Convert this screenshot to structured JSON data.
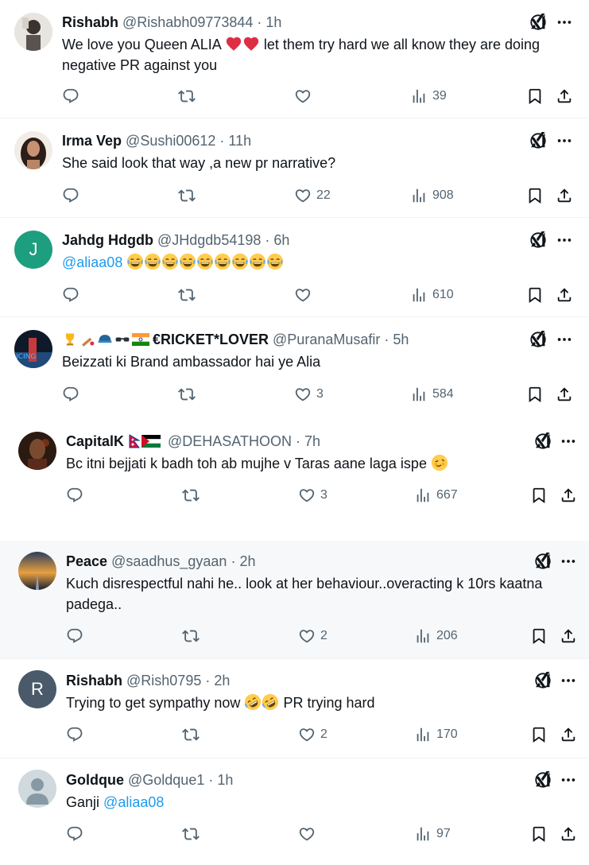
{
  "tweets": [
    {
      "name": "Rishabh",
      "handle": "@Rishabh09773844",
      "time": "1h",
      "text": "We love you Queen ALIA",
      "text2": "let them try hard we all know they are doing",
      "text3": "negative PR against you",
      "likes": "",
      "views": "39",
      "avatar": "photo"
    },
    {
      "name": "Irma Vep",
      "handle": "@Sushi00612",
      "time": "11h",
      "text": "She said look that way ,a new pr narrative?",
      "likes": "22",
      "views": "908",
      "avatar": "photo"
    },
    {
      "name": "Jahdg Hdgdb",
      "handle": "@JHdgdb54198",
      "time": "6h",
      "mention": "@aliaa08",
      "likes": "",
      "views": "610",
      "avatar_letter": "J",
      "avatar_color": "#1d9e7e"
    },
    {
      "name": "€RICKET*LOVER",
      "handle": "@PuranaMusafir",
      "time": "5h",
      "text": "Beizzati ki Brand ambassador hai ye Alia",
      "likes": "3",
      "views": "584",
      "avatar": "photo"
    },
    {
      "name": "CapitalK",
      "handle": "@DEHASATHOON",
      "time": "7h",
      "text": "Bc itni bejjati k badh toh ab mujhe v Taras aane laga ispe",
      "likes": "3",
      "views": "667",
      "avatar": "photo"
    },
    {
      "name": "Peace",
      "handle": "@saadhus_gyaan",
      "time": "2h",
      "text": "Kuch disrespectful nahi he.. look at her behaviour..overacting k 10rs kaatna",
      "text2": "padega..",
      "likes": "2",
      "views": "206",
      "avatar": "photo"
    },
    {
      "name": "Rishabh",
      "handle": "@Rish0795",
      "time": "2h",
      "text": "Trying to get sympathy now",
      "text2": "PR trying hard",
      "likes": "2",
      "views": "170",
      "avatar_letter": "R",
      "avatar_color": "#4a5a6a"
    },
    {
      "name": "Goldque",
      "handle": "@Goldque1",
      "time": "1h",
      "text": "Ganji",
      "mention": "@aliaa08",
      "likes": "",
      "views": "97",
      "avatar": "default"
    }
  ],
  "icons": {
    "reply": "reply-icon",
    "retweet": "retweet-icon",
    "like": "like-icon",
    "views": "views-icon",
    "bookmark": "bookmark-icon",
    "share": "share-icon",
    "grok": "grok-icon",
    "more": "more-icon"
  },
  "colors": {
    "text": "#0f1419",
    "secondary": "#536471",
    "link": "#1d9bf0"
  }
}
